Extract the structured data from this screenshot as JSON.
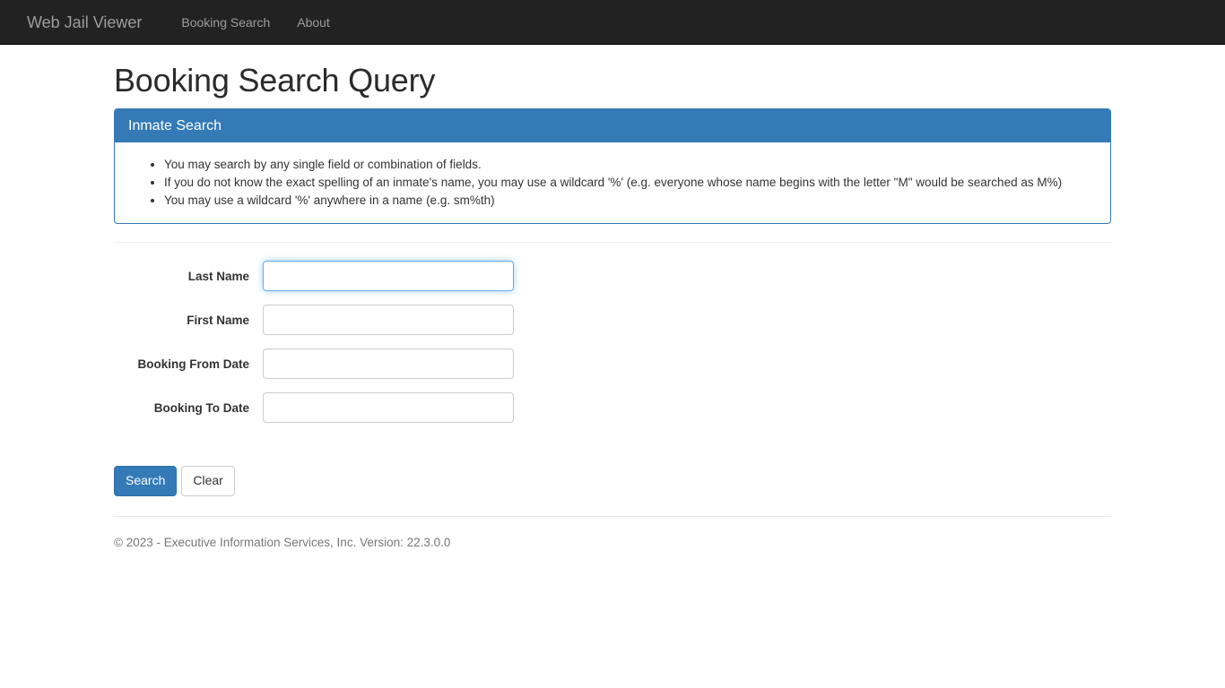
{
  "navbar": {
    "brand": "Web Jail Viewer",
    "links": [
      {
        "label": "Booking Search"
      },
      {
        "label": "About"
      }
    ]
  },
  "page": {
    "title": "Booking Search Query"
  },
  "panel": {
    "heading": "Inmate Search",
    "bullets": [
      "You may search by any single field or combination of fields.",
      "If you do not know the exact spelling of an inmate's name, you may use a wildcard '%' (e.g. everyone whose name begins with the letter \"M\" would be searched as M%)",
      "You may use a wildcard '%' anywhere in a name (e.g. sm%th)"
    ]
  },
  "form": {
    "fields": [
      {
        "label": "Last Name",
        "value": "",
        "placeholder": ""
      },
      {
        "label": "First Name",
        "value": "",
        "placeholder": ""
      },
      {
        "label": "Booking From Date",
        "value": "",
        "placeholder": ""
      },
      {
        "label": "Booking To Date",
        "value": "",
        "placeholder": ""
      }
    ],
    "buttons": {
      "search": "Search",
      "clear": "Clear"
    }
  },
  "footer": {
    "text": "© 2023 - Executive Information Services, Inc. Version: 22.3.0.0"
  },
  "colors": {
    "navbar_bg": "#222222",
    "panel_accent": "#337ab7",
    "primary_button": "#337ab7",
    "focus_ring": "#66afe9"
  }
}
